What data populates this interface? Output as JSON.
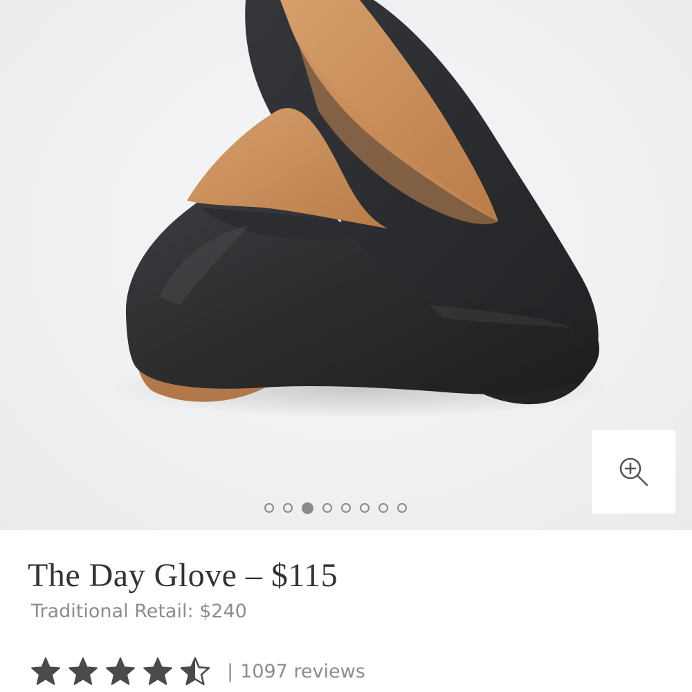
{
  "gallery": {
    "image_alt": "Black leather flat shoes",
    "slide_count": 8,
    "active_slide": 3,
    "zoom_icon": "zoom-in-icon"
  },
  "product": {
    "title": "The Day Glove – $115",
    "traditional_retail": "Traditional Retail: $240"
  },
  "reviews": {
    "rating": 4.5,
    "max_rating": 5,
    "separator": "|",
    "count_text": "1097 reviews",
    "star_color": "#4a4a4a"
  },
  "colors": {
    "hero_background": "#f0f0f2",
    "title_text": "#333333",
    "muted_text": "#8c8c8c"
  }
}
